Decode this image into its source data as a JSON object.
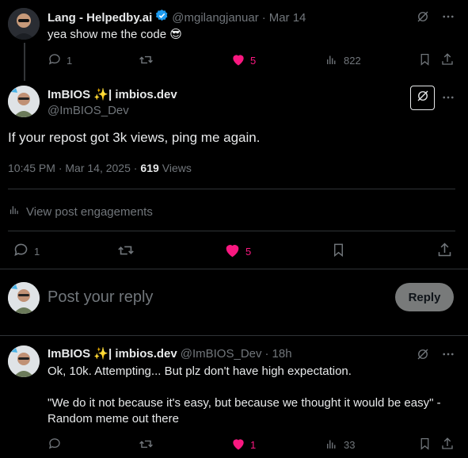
{
  "parent_tweet": {
    "display_name": "Lang - Helpedby.ai",
    "handle": "@mgilangjanuar",
    "date": "Mar 14",
    "text": "yea show me the code 😎",
    "replies": "1",
    "likes": "5",
    "views": "822"
  },
  "main_tweet": {
    "display_name": "ImBIOS ✨| imbios.dev",
    "handle": "@ImBIOS_Dev",
    "text": "If your repost got 3k views, ping me again.",
    "time": "10:45 PM · Mar 14, 2025 · ",
    "view_count": "619",
    "views_label": "Views",
    "engagements_label": "View post engagements",
    "replies": "1",
    "likes": "5"
  },
  "compose": {
    "placeholder": "Post your reply",
    "reply_button": "Reply"
  },
  "reply_tweet": {
    "display_name": "ImBIOS ✨| imbios.dev",
    "handle": "@ImBIOS_Dev",
    "date": "18h",
    "text_line1": "Ok, 10k. Attempting... But plz don't have high expectation.",
    "text_line2": "\"We do it not because it's easy, but because we thought it would be easy\" -",
    "text_line3": "Random meme out there",
    "likes": "1",
    "views": "33"
  },
  "colors": {
    "background": "#000000",
    "text": "#e7e9ea",
    "muted": "#71767b",
    "like": "#f91880",
    "verified": "#1d9bf0",
    "divider": "#2f3336"
  }
}
